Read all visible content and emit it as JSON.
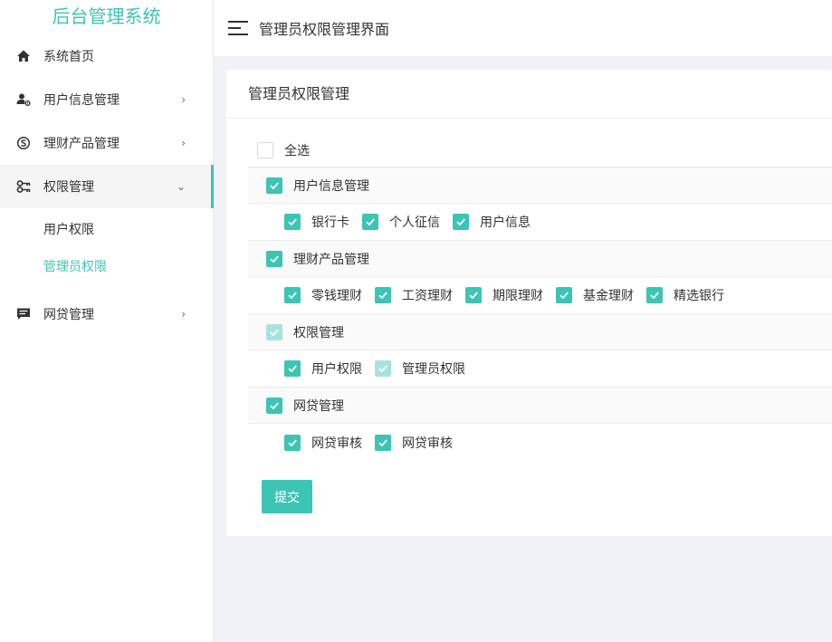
{
  "app_title": "后台管理系统",
  "header": {
    "title": "管理员权限管理界面"
  },
  "sidebar": {
    "items": [
      {
        "label": "系统首页",
        "icon": "home-icon",
        "arrow": ""
      },
      {
        "label": "用户信息管理",
        "icon": "user-settings-icon",
        "arrow": "›"
      },
      {
        "label": "理财产品管理",
        "icon": "skype-like-icon",
        "arrow": "›"
      },
      {
        "label": "权限管理",
        "icon": "key-icon",
        "arrow": "⌄",
        "sub": [
          "用户权限",
          "管理员权限"
        ]
      },
      {
        "label": "网贷管理",
        "icon": "message-icon",
        "arrow": "›"
      }
    ]
  },
  "card": {
    "title": "管理员权限管理",
    "select_all": "全选",
    "groups": [
      {
        "label": "用户信息管理",
        "state": "checked",
        "children": [
          {
            "label": "银行卡",
            "state": "checked"
          },
          {
            "label": "个人征信",
            "state": "checked"
          },
          {
            "label": "用户信息",
            "state": "checked"
          }
        ]
      },
      {
        "label": "理财产品管理",
        "state": "checked",
        "children": [
          {
            "label": "零钱理财",
            "state": "checked"
          },
          {
            "label": "工资理财",
            "state": "checked"
          },
          {
            "label": "期限理财",
            "state": "checked"
          },
          {
            "label": "基金理财",
            "state": "checked"
          },
          {
            "label": "精选银行",
            "state": "checked"
          }
        ]
      },
      {
        "label": "权限管理",
        "state": "dim",
        "children": [
          {
            "label": "用户权限",
            "state": "checked"
          },
          {
            "label": "管理员权限",
            "state": "dim"
          }
        ]
      },
      {
        "label": "网贷管理",
        "state": "checked",
        "children": [
          {
            "label": "网贷审核",
            "state": "checked"
          },
          {
            "label": "网贷审核",
            "state": "checked"
          }
        ]
      }
    ],
    "submit_label": "提交"
  },
  "colors": {
    "accent": "#3cc4b4",
    "accent_dim": "#a7e3dc"
  }
}
